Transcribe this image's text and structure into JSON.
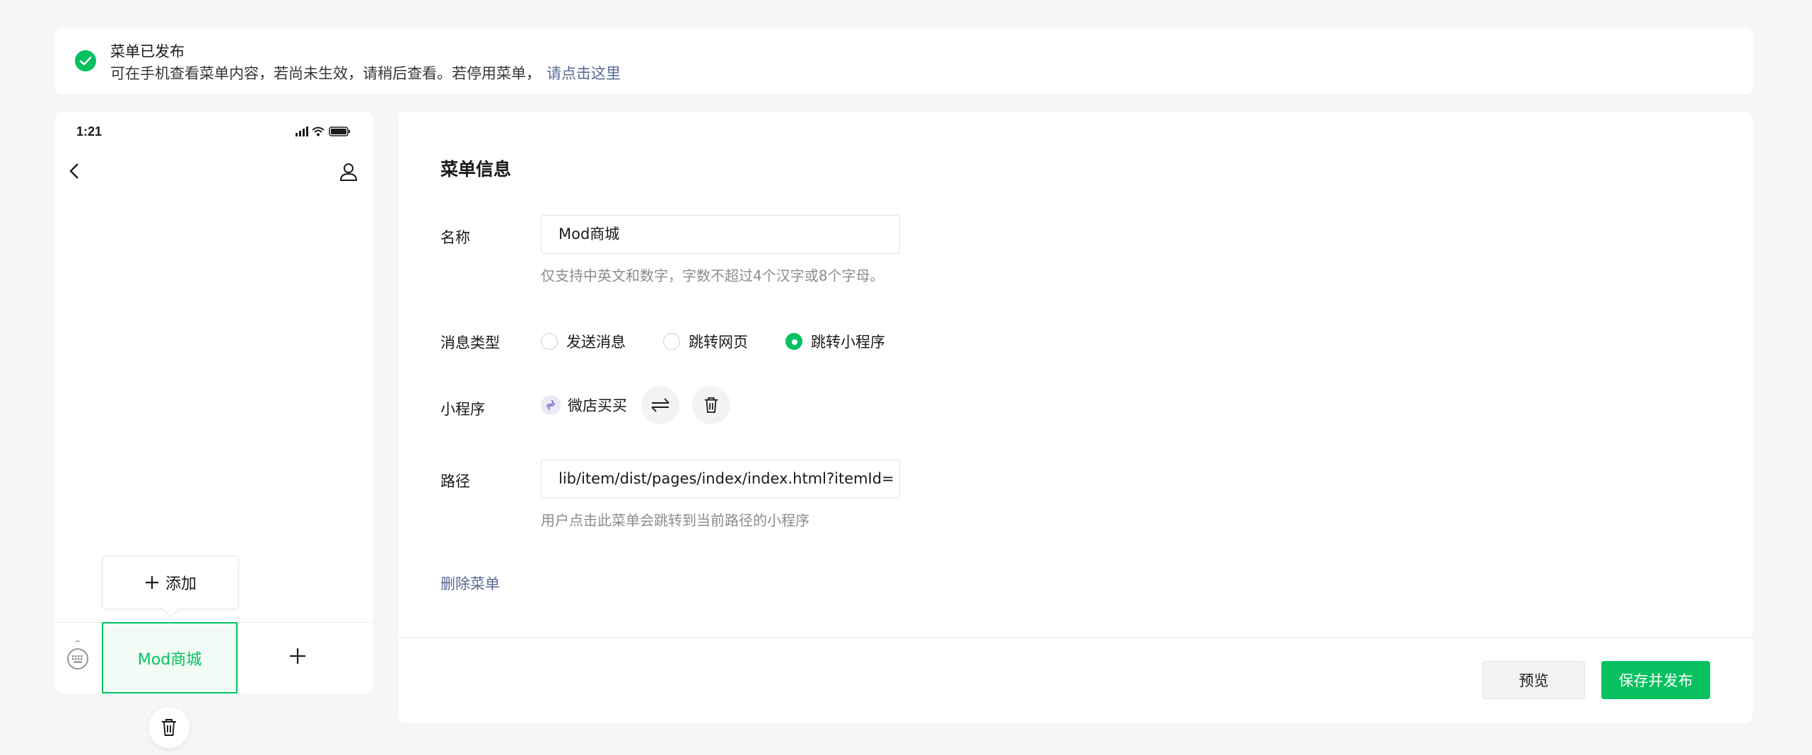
{
  "notice": {
    "title": "菜单已发布",
    "message": "可在手机查看菜单内容，若尚未生效，请稍后查看。若停用菜单，",
    "link": "请点击这里"
  },
  "phone": {
    "time": "1:21",
    "add_sub_label": "添加",
    "menu_item": "Mod商城"
  },
  "form": {
    "title": "菜单信息",
    "name_label": "名称",
    "name_value": "Mod商城",
    "name_hint": "仅支持中英文和数字，字数不超过4个汉字或8个字母。",
    "type_label": "消息类型",
    "type_options": [
      "发送消息",
      "跳转网页",
      "跳转小程序"
    ],
    "type_selected": "跳转小程序",
    "miniprogram_label": "小程序",
    "miniprogram_name": "微店买买",
    "path_label": "路径",
    "path_value": "lib/item/dist/pages/index/index.html?itemId=",
    "path_hint": "用户点击此菜单会跳转到当前路径的小程序",
    "delete_label": "删除菜单"
  },
  "actions": {
    "preview": "预览",
    "publish": "保存并发布"
  },
  "colors": {
    "accent": "#07c160",
    "link": "#576b95"
  }
}
